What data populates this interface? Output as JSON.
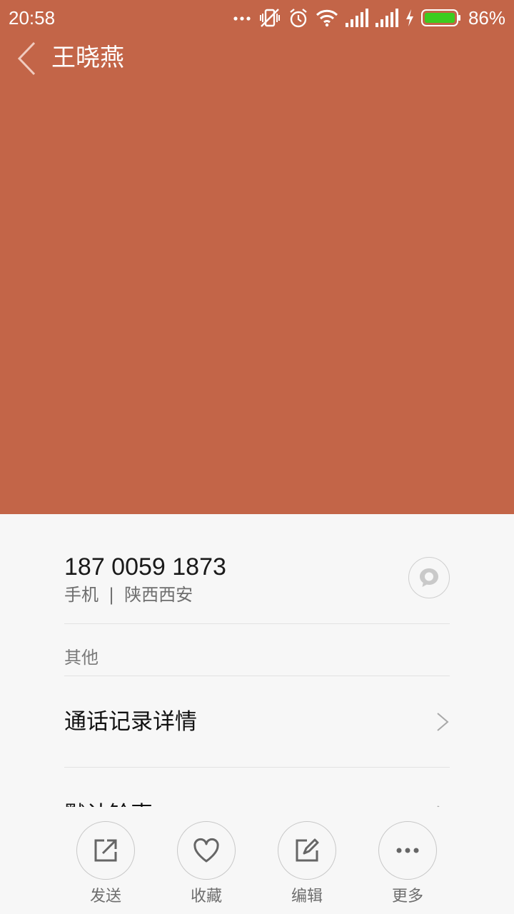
{
  "status_bar": {
    "time": "20:58",
    "battery_percent": "86%",
    "icons": [
      "more-dots-icon",
      "vibrate-off-icon",
      "alarm-icon",
      "wifi-icon",
      "signal-icon",
      "signal-icon",
      "charging-icon",
      "battery-icon"
    ],
    "battery_color": "#3ccc1f"
  },
  "header": {
    "contact_name": "王晓燕",
    "background_color": "#c36548"
  },
  "phone": {
    "number": "187 0059 1873",
    "type": "手机",
    "separator": "|",
    "location": "陕西西安"
  },
  "section": {
    "other_label": "其他"
  },
  "rows": [
    {
      "label": "通话记录详情"
    },
    {
      "label": "默认铃声"
    }
  ],
  "actions": [
    {
      "label": "发送",
      "icon": "share-icon"
    },
    {
      "label": "收藏",
      "icon": "heart-icon"
    },
    {
      "label": "编辑",
      "icon": "edit-icon"
    },
    {
      "label": "更多",
      "icon": "more-icon"
    }
  ]
}
